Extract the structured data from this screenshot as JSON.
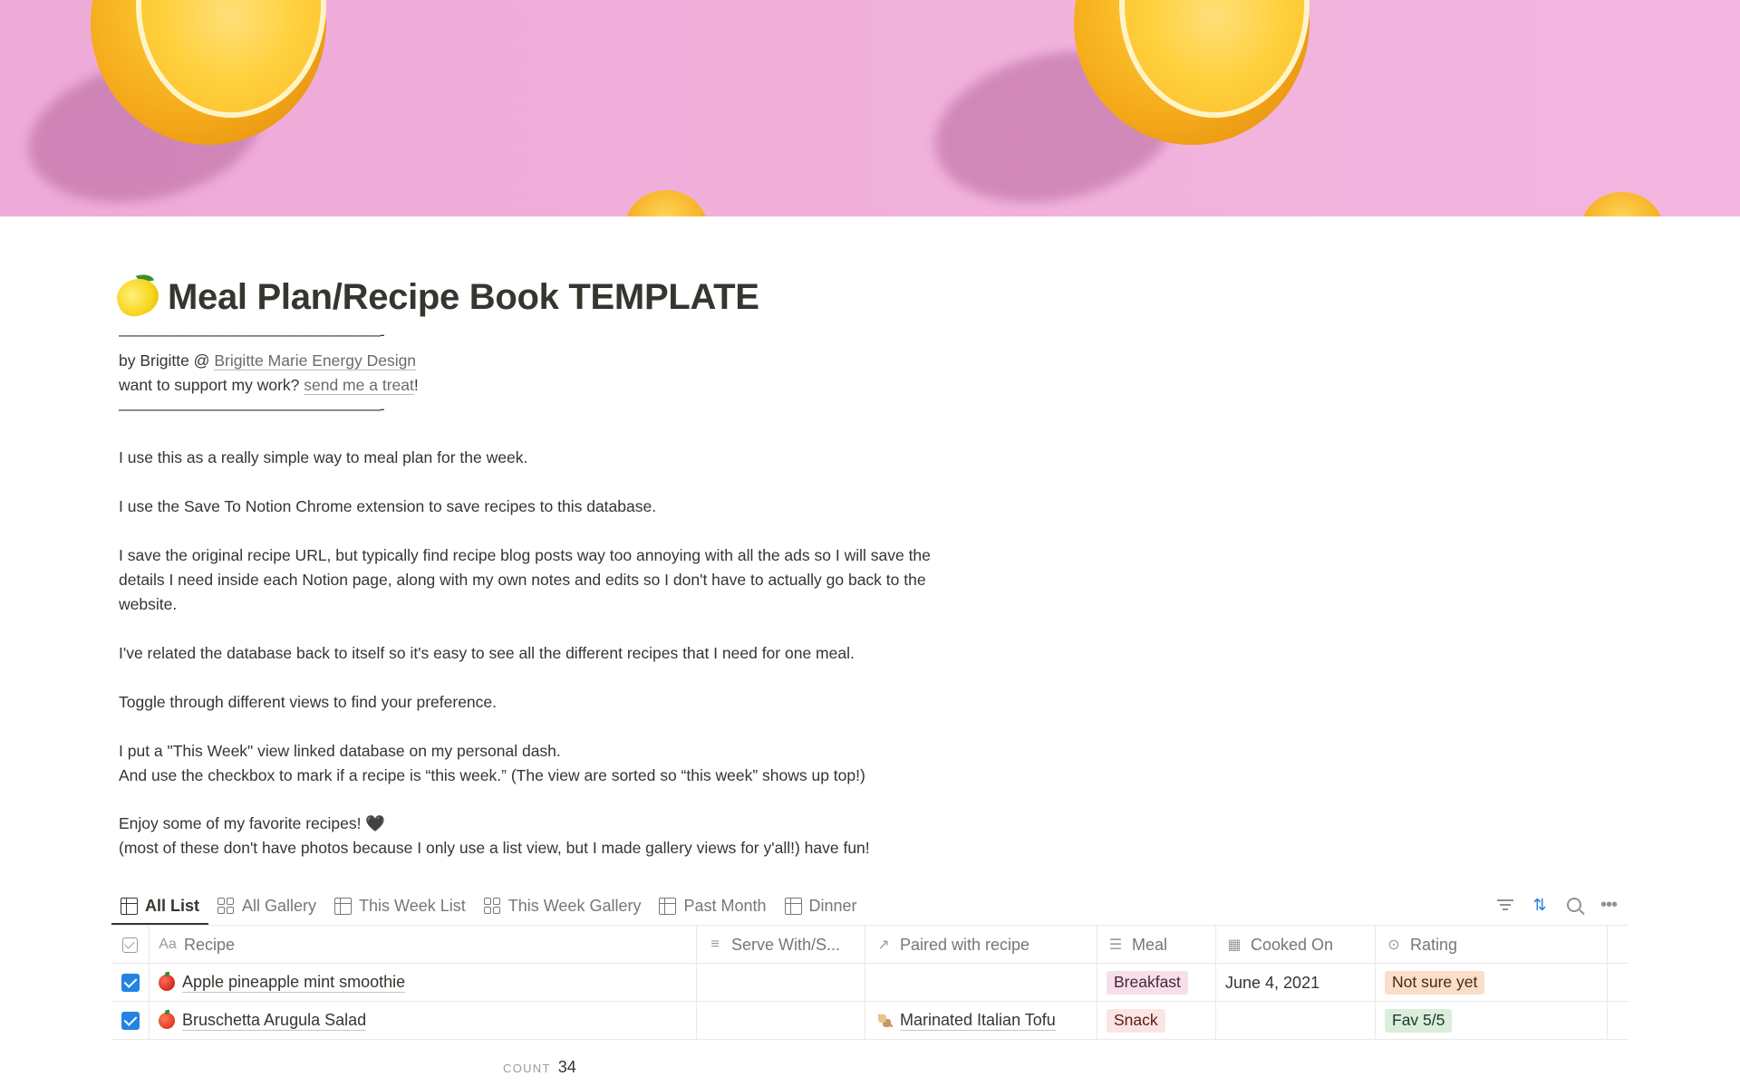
{
  "page": {
    "title": "Meal Plan/Recipe Book TEMPLATE",
    "title_icon": "lemon-emoji",
    "divider_text": "——————————————————-",
    "byline_prefix": "by Brigitte @ ",
    "byline_link": "Brigitte Marie Energy Design",
    "support_prefix": "want to support my work? ",
    "support_link": "send me a treat",
    "support_suffix": "!",
    "paragraphs": [
      "I use this as a really simple way to meal plan for the week.",
      "I use the Save To Notion Chrome extension to save recipes to this database.",
      "I save the original recipe URL, but typically find recipe blog posts way too annoying with all the ads so I will save the",
      "details I need inside each Notion page, along with my own notes and edits so I don't have to actually go back to the",
      "website.",
      "I've related the database back to itself so it's easy to see all the different recipes that I need for one meal.",
      "Toggle through different views to find your preference.",
      "I put a \"This Week\" view linked database on my personal dash.",
      "And use the checkbox to mark if a recipe is “this week.” (The view are sorted so “this week” shows up top!)",
      "Enjoy some of my favorite recipes! 🖤",
      "(most of these don't have photos because I only use a list view, but I made gallery views for y'all!) have fun!"
    ]
  },
  "views": {
    "tabs": [
      {
        "label": "All List",
        "icon": "table-icon",
        "active": true
      },
      {
        "label": "All Gallery",
        "icon": "gallery-icon",
        "active": false
      },
      {
        "label": "This Week List",
        "icon": "table-icon",
        "active": false
      },
      {
        "label": "This Week Gallery",
        "icon": "gallery-icon",
        "active": false
      },
      {
        "label": "Past Month",
        "icon": "table-icon",
        "active": false
      },
      {
        "label": "Dinner",
        "icon": "table-icon",
        "active": false
      }
    ],
    "actions": [
      "filter-icon",
      "sort-icon",
      "search-icon",
      "more-icon"
    ]
  },
  "table": {
    "columns": [
      {
        "label": "",
        "icon": "checkbox-icon"
      },
      {
        "label": "Recipe",
        "icon": "title-aa-icon"
      },
      {
        "label": "Serve With/S...",
        "icon": "text-lines-icon"
      },
      {
        "label": "Paired with recipe",
        "icon": "relation-arrow-icon"
      },
      {
        "label": "Meal",
        "icon": "list-icon"
      },
      {
        "label": "Cooked On",
        "icon": "calendar-icon"
      },
      {
        "label": "Rating",
        "icon": "select-icon"
      }
    ],
    "rows": [
      {
        "checked": true,
        "recipe": "Apple pineapple mint smoothie",
        "recipe_icon": "apple-emoji",
        "serve_with": "",
        "paired": "",
        "meal": "Breakfast",
        "meal_color": "#f5e0e9",
        "cooked_on": "June 4, 2021",
        "rating": "Not sure yet",
        "rating_color": "#fadec9"
      },
      {
        "checked": true,
        "recipe": "Bruschetta Arugula Salad",
        "recipe_icon": "tomato-emoji",
        "serve_with": "",
        "paired": "Marinated Italian Tofu",
        "paired_icon": "skewer-emoji",
        "meal": "Snack",
        "meal_color": "#fbe4e4",
        "cooked_on": "",
        "rating": "Fav 5/5",
        "rating_color": "#dbeddb"
      }
    ],
    "count_label": "COUNT",
    "count_value": "34"
  }
}
